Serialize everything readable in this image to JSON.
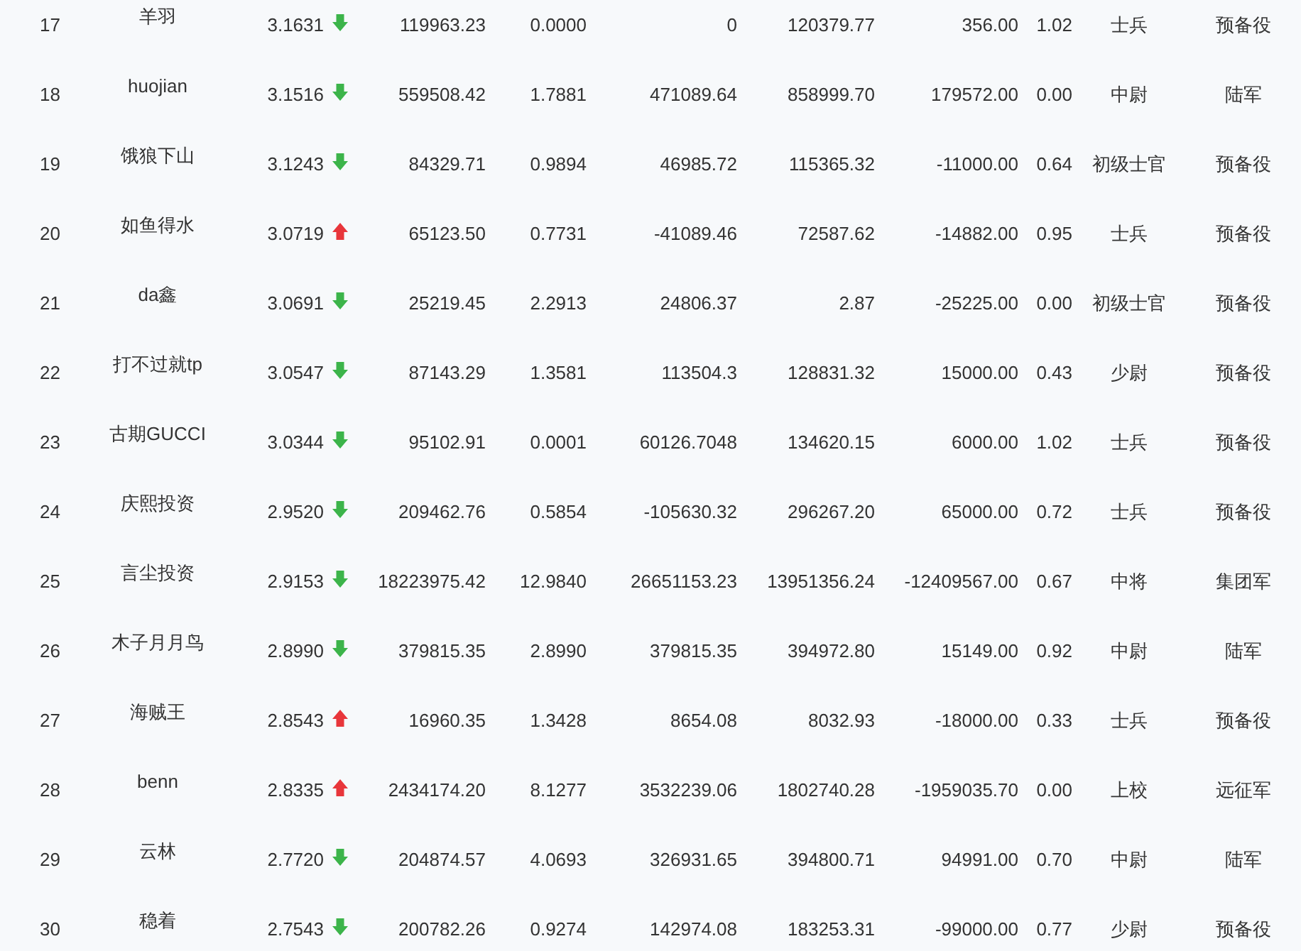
{
  "table": {
    "rows": [
      {
        "rank": "17",
        "name": "羊羽",
        "score": "3.1631",
        "trend": {
          "kind": "down"
        },
        "column_4": "119963.23",
        "column_5": "0.0000",
        "column_6": "0",
        "column_7": "120379.77",
        "column_8": "356.00",
        "column_9": "1.02",
        "column_10": "士兵",
        "column_11": "预备役"
      },
      {
        "rank": "18",
        "name": "huojian",
        "score": "3.1516",
        "trend": {
          "kind": "down"
        },
        "column_4": "559508.42",
        "column_5": "1.7881",
        "column_6": "471089.64",
        "column_7": "858999.70",
        "column_8": "179572.00",
        "column_9": "0.00",
        "column_10": "中尉",
        "column_11": "陆军"
      },
      {
        "rank": "19",
        "name": "饿狼下山",
        "score": "3.1243",
        "trend": {
          "kind": "down"
        },
        "column_4": "84329.71",
        "column_5": "0.9894",
        "column_6": "46985.72",
        "column_7": "115365.32",
        "column_8": "-11000.00",
        "column_9": "0.64",
        "column_10": "初级士官",
        "column_11": "预备役"
      },
      {
        "rank": "20",
        "name": "如鱼得水",
        "score": "3.0719",
        "trend": {
          "kind": "up"
        },
        "column_4": "65123.50",
        "column_5": "0.7731",
        "column_6": "-41089.46",
        "column_7": "72587.62",
        "column_8": "-14882.00",
        "column_9": "0.95",
        "column_10": "士兵",
        "column_11": "预备役"
      },
      {
        "rank": "21",
        "name": "da鑫",
        "score": "3.0691",
        "trend": {
          "kind": "down"
        },
        "column_4": "25219.45",
        "column_5": "2.2913",
        "column_6": "24806.37",
        "column_7": "2.87",
        "column_8": "-25225.00",
        "column_9": "0.00",
        "column_10": "初级士官",
        "column_11": "预备役"
      },
      {
        "rank": "22",
        "name": "打不过就tp",
        "score": "3.0547",
        "trend": {
          "kind": "down"
        },
        "column_4": "87143.29",
        "column_5": "1.3581",
        "column_6": "113504.3",
        "column_7": "128831.32",
        "column_8": "15000.00",
        "column_9": "0.43",
        "column_10": "少尉",
        "column_11": "预备役"
      },
      {
        "rank": "23",
        "name": "古期GUCCI",
        "score": "3.0344",
        "trend": {
          "kind": "down"
        },
        "column_4": "95102.91",
        "column_5": "0.0001",
        "column_6": "60126.7048",
        "column_7": "134620.15",
        "column_8": "6000.00",
        "column_9": "1.02",
        "column_10": "士兵",
        "column_11": "预备役"
      },
      {
        "rank": "24",
        "name": "庆熙投资",
        "score": "2.9520",
        "trend": {
          "kind": "down"
        },
        "column_4": "209462.76",
        "column_5": "0.5854",
        "column_6": "-105630.32",
        "column_7": "296267.20",
        "column_8": "65000.00",
        "column_9": "0.72",
        "column_10": "士兵",
        "column_11": "预备役"
      },
      {
        "rank": "25",
        "name": "言尘投资",
        "score": "2.9153",
        "trend": {
          "kind": "down"
        },
        "column_4": "18223975.42",
        "column_5": "12.9840",
        "column_6": "26651153.23",
        "column_7": "13951356.24",
        "column_8": "-12409567.00",
        "column_9": "0.67",
        "column_10": "中将",
        "column_11": "集团军"
      },
      {
        "rank": "26",
        "name": "木子月月鸟",
        "score": "2.8990",
        "trend": {
          "kind": "down"
        },
        "column_4": "379815.35",
        "column_5": "2.8990",
        "column_6": "379815.35",
        "column_7": "394972.80",
        "column_8": "15149.00",
        "column_9": "0.92",
        "column_10": "中尉",
        "column_11": "陆军"
      },
      {
        "rank": "27",
        "name": "海贼王",
        "score": "2.8543",
        "trend": {
          "kind": "up"
        },
        "column_4": "16960.35",
        "column_5": "1.3428",
        "column_6": "8654.08",
        "column_7": "8032.93",
        "column_8": "-18000.00",
        "column_9": "0.33",
        "column_10": "士兵",
        "column_11": "预备役"
      },
      {
        "rank": "28",
        "name": "benn",
        "score": "2.8335",
        "trend": {
          "kind": "up"
        },
        "column_4": "2434174.20",
        "column_5": "8.1277",
        "column_6": "3532239.06",
        "column_7": "1802740.28",
        "column_8": "-1959035.70",
        "column_9": "0.00",
        "column_10": "上校",
        "column_11": "远征军"
      },
      {
        "rank": "29",
        "name": "云林",
        "score": "2.7720",
        "trend": {
          "kind": "down"
        },
        "column_4": "204874.57",
        "column_5": "4.0693",
        "column_6": "326931.65",
        "column_7": "394800.71",
        "column_8": "94991.00",
        "column_9": "0.70",
        "column_10": "中尉",
        "column_11": "陆军"
      },
      {
        "rank": "30",
        "name": "稳着",
        "score": "2.7543",
        "trend": {
          "kind": "down"
        },
        "column_4": "200782.26",
        "column_5": "0.9274",
        "column_6": "142974.08",
        "column_7": "183253.31",
        "column_8": "-99000.00",
        "column_9": "0.77",
        "column_10": "少尉",
        "column_11": "预备役"
      }
    ]
  }
}
